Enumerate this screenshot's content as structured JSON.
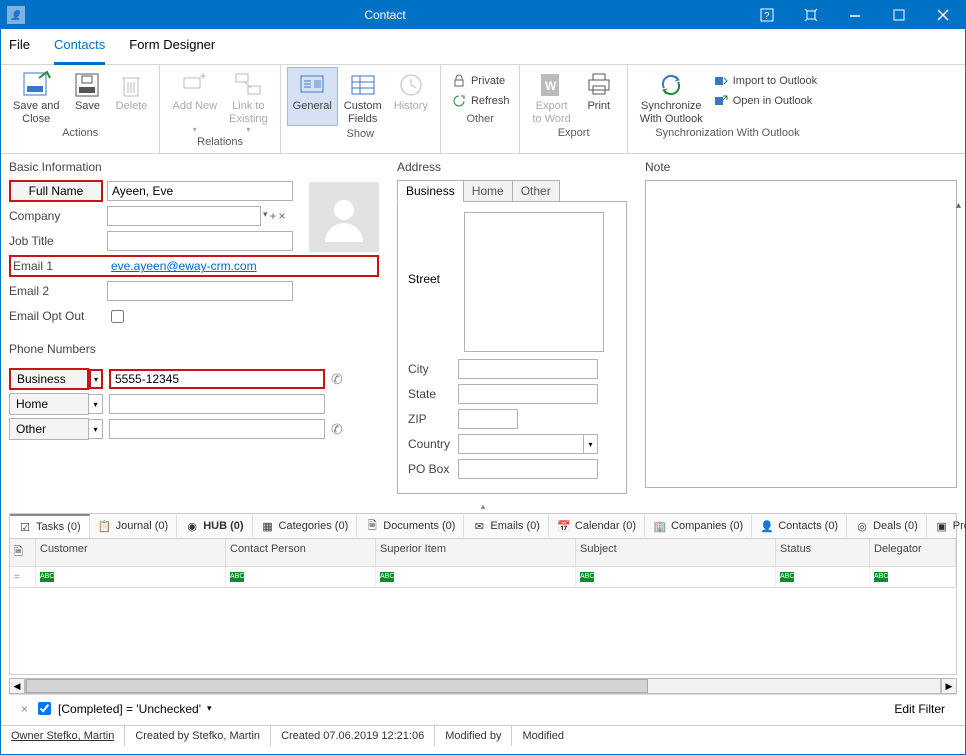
{
  "titlebar": {
    "title": "Contact"
  },
  "tabs": {
    "file": "File",
    "contacts": "Contacts",
    "form_designer": "Form Designer"
  },
  "ribbon": {
    "actions": {
      "label": "Actions",
      "save_close": "Save and\nClose",
      "save": "Save",
      "delete": "Delete"
    },
    "relations": {
      "label": "Relations",
      "add_new": "Add New",
      "link_existing": "Link to\nExisting"
    },
    "show": {
      "label": "Show",
      "general": "General",
      "custom_fields": "Custom\nFields",
      "history": "History"
    },
    "other": {
      "label": "Other",
      "private": "Private",
      "refresh": "Refresh"
    },
    "export": {
      "label": "Export",
      "word": "Export\nto Word",
      "print": "Print"
    },
    "sync": {
      "label": "Synchronization With Outlook",
      "sync": "Synchronize\nWith Outlook",
      "import": "Import to Outlook",
      "open": "Open in Outlook"
    }
  },
  "basic": {
    "section": "Basic Information",
    "full_name_btn": "Full Name",
    "full_name_val": "Ayeen, Eve",
    "company": "Company",
    "job_title": "Job Title",
    "email1": "Email 1",
    "email1_val": "eve.ayeen@eway-crm.com",
    "email2": "Email 2",
    "opt_out": "Email Opt Out"
  },
  "phone": {
    "section": "Phone Numbers",
    "business": "Business",
    "business_val": "5555-12345",
    "home": "Home",
    "other": "Other"
  },
  "address": {
    "section": "Address",
    "tabs": {
      "business": "Business",
      "home": "Home",
      "other": "Other"
    },
    "street": "Street",
    "city": "City",
    "state": "State",
    "zip": "ZIP",
    "country": "Country",
    "pobox": "PO Box"
  },
  "note": {
    "section": "Note"
  },
  "bottom_tabs": {
    "tasks": "Tasks (0)",
    "journal": "Journal (0)",
    "hub": "HUB (0)",
    "categories": "Categories (0)",
    "documents": "Documents (0)",
    "emails": "Emails (0)",
    "calendar": "Calendar (0)",
    "companies": "Companies (0)",
    "contacts": "Contacts (0)",
    "deals": "Deals (0)",
    "project": "Project"
  },
  "grid": {
    "cols": {
      "customer": "Customer",
      "contact": "Contact Person",
      "superior": "Superior Item",
      "subject": "Subject",
      "status": "Status",
      "delegator": "Delegator"
    }
  },
  "filterbar": {
    "text": "[Completed] = 'Unchecked'",
    "edit": "Edit Filter"
  },
  "statusbar": {
    "owner": "Owner Stefko, Martin",
    "created_by": "Created by Stefko, Martin",
    "created": "Created 07.06.2019 12:21:06",
    "modified_by": "Modified by",
    "modified": "Modified"
  }
}
